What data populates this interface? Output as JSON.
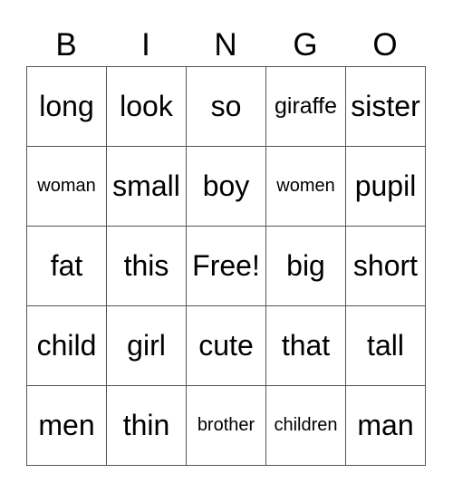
{
  "header": [
    "B",
    "I",
    "N",
    "G",
    "O"
  ],
  "cells": [
    [
      "long",
      "look",
      "so",
      "giraffe",
      "sister"
    ],
    [
      "woman",
      "small",
      "boy",
      "women",
      "pupil"
    ],
    [
      "fat",
      "this",
      "Free!",
      "big",
      "short"
    ],
    [
      "child",
      "girl",
      "cute",
      "that",
      "tall"
    ],
    [
      "men",
      "thin",
      "brother",
      "children",
      "man"
    ]
  ]
}
